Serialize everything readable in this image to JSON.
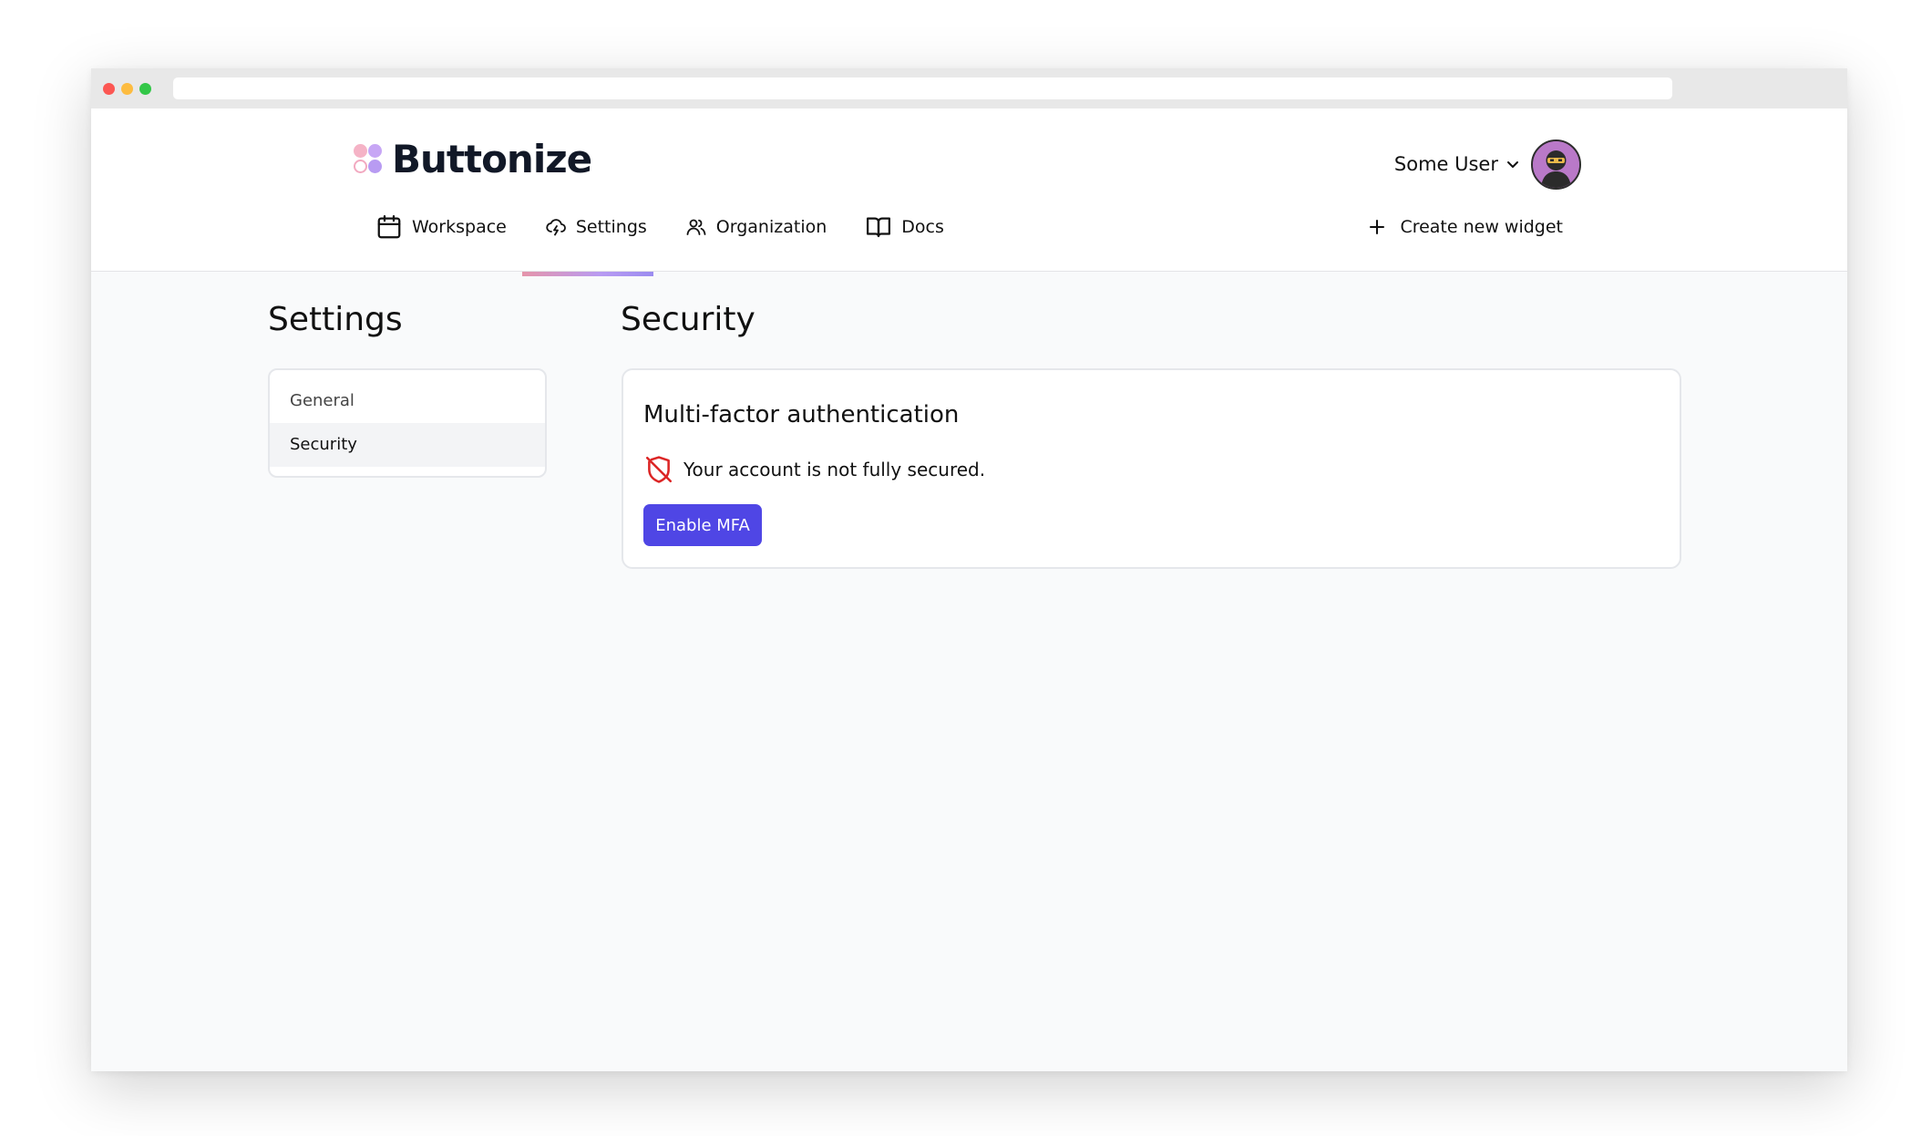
{
  "brand": {
    "name": "Buttonize",
    "colors": {
      "pink": "#f2a9c0",
      "purple": "#b89bf2",
      "accent": "#4f46e5",
      "danger": "#dc2626"
    }
  },
  "user": {
    "name": "Some User",
    "avatar_icon": "ninja-avatar"
  },
  "nav": {
    "items": [
      {
        "label": "Workspace",
        "icon": "calendar-icon"
      },
      {
        "label": "Settings",
        "icon": "cloud-lightning-icon",
        "active": true
      },
      {
        "label": "Organization",
        "icon": "users-icon"
      },
      {
        "label": "Docs",
        "icon": "book-open-icon"
      }
    ],
    "create_label": "Create new widget"
  },
  "settings": {
    "title": "Settings",
    "menu": [
      {
        "label": "General"
      },
      {
        "label": "Security",
        "active": true
      }
    ]
  },
  "security": {
    "title": "Security",
    "mfa": {
      "title": "Multi-factor authentication",
      "status": "Your account is not fully secured.",
      "button": "Enable MFA"
    }
  }
}
